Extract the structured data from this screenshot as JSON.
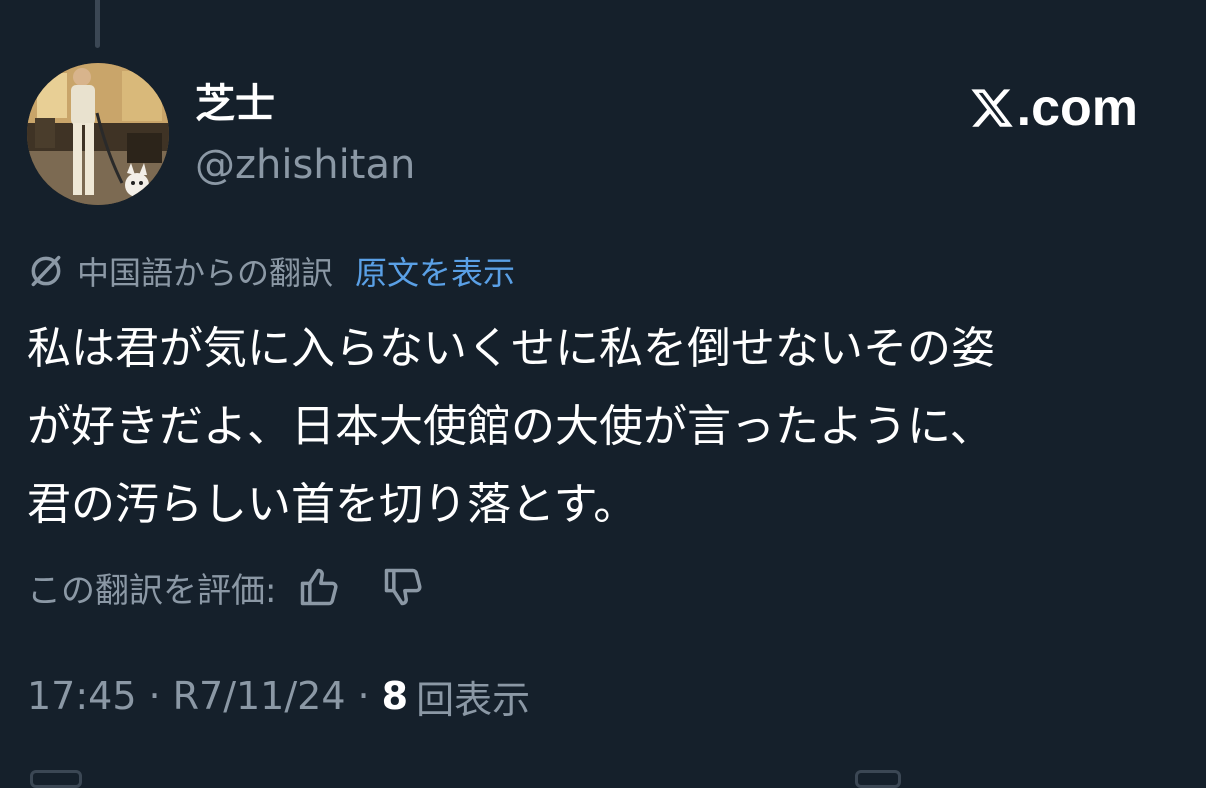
{
  "author": {
    "display_name": "芝士",
    "handle": "@zhishitan"
  },
  "brand": {
    "text": ".com",
    "icon": "x-logo-icon"
  },
  "translation": {
    "icon": "globe-slash-icon",
    "label": "中国語からの翻訳",
    "show_original": "原文を表示"
  },
  "post": {
    "text": "私は君が気に入らないくせに私を倒せないその姿\nが好きだよ、日本大使館の大使が言ったように、\n君の汚らしい首を切り落とす。"
  },
  "rating": {
    "label": "この翻訳を評価:",
    "like_icon": "thumbs-up-icon",
    "dislike_icon": "thumbs-down-icon"
  },
  "meta": {
    "time": "17:45",
    "separator": "·",
    "date": "R7/11/24",
    "views_count": "8",
    "views_label": "回表示"
  },
  "colors": {
    "background": "#15202b",
    "text_primary": "#ffffff",
    "text_secondary": "#8b98a5",
    "link": "#5aa0e6"
  }
}
